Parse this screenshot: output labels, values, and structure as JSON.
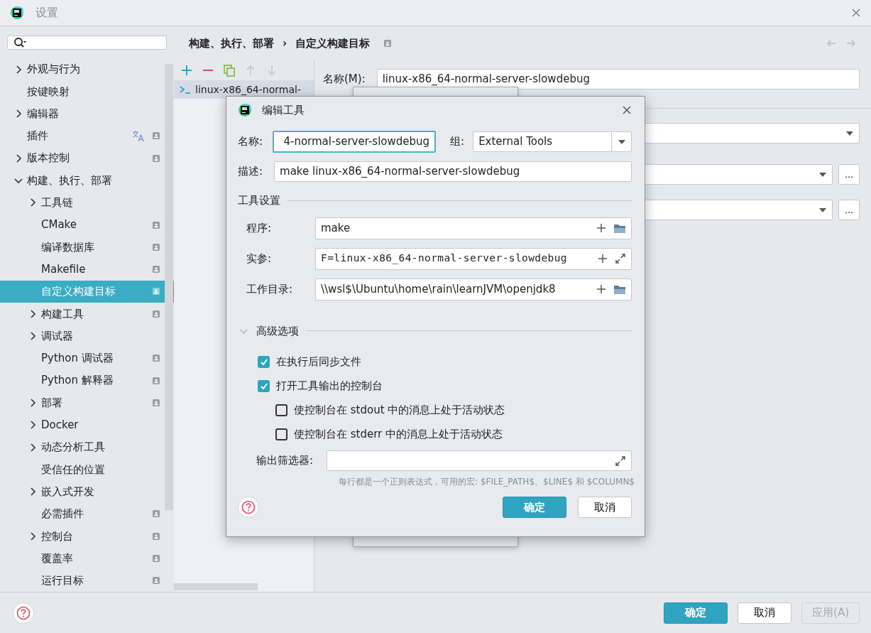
{
  "window": {
    "title": "设置"
  },
  "sidebar": {
    "items": [
      {
        "label": "外观与行为",
        "expanded": false,
        "badge": false,
        "selected": false
      },
      {
        "label": "按键映射",
        "badge": false,
        "selected": false
      },
      {
        "label": "编辑器",
        "expanded": false,
        "badge": false,
        "selected": false
      },
      {
        "label": "插件",
        "badge": true,
        "selected": false,
        "translate_icon": true
      },
      {
        "label": "版本控制",
        "expanded": false,
        "badge": true,
        "selected": false
      },
      {
        "label": "构建、执行、部署",
        "expanded": true,
        "badge": false,
        "selected": false,
        "children": [
          {
            "label": "工具链",
            "expanded": false,
            "badge": false,
            "selected": false
          },
          {
            "label": "CMake",
            "badge": true,
            "selected": false
          },
          {
            "label": "编译数据库",
            "badge": true,
            "selected": false
          },
          {
            "label": "Makefile",
            "badge": true,
            "selected": false
          },
          {
            "label": "自定义构建目标",
            "badge": true,
            "selected": true
          },
          {
            "label": "构建工具",
            "expanded": false,
            "badge": true,
            "selected": false
          },
          {
            "label": "调试器",
            "expanded": false,
            "badge": false,
            "selected": false
          },
          {
            "label": "Python 调试器",
            "badge": true,
            "selected": false
          },
          {
            "label": "Python 解释器",
            "badge": true,
            "selected": false
          },
          {
            "label": "部署",
            "expanded": false,
            "badge": true,
            "selected": false
          },
          {
            "label": "Docker",
            "expanded": false,
            "badge": false,
            "selected": false
          },
          {
            "label": "动态分析工具",
            "expanded": false,
            "badge": false,
            "selected": false
          },
          {
            "label": "受信任的位置",
            "badge": false,
            "selected": false
          },
          {
            "label": "嵌入式开发",
            "expanded": false,
            "badge": false,
            "selected": false
          },
          {
            "label": "必需插件",
            "badge": true,
            "selected": false
          },
          {
            "label": "控制台",
            "expanded": false,
            "badge": true,
            "selected": false
          },
          {
            "label": "覆盖率",
            "badge": true,
            "selected": false
          },
          {
            "label": "运行目标",
            "badge": true,
            "selected": false
          }
        ]
      }
    ]
  },
  "breadcrumb": {
    "items": [
      "构建、执行、部署",
      "自定义构建目标"
    ],
    "separator": "›",
    "badge": true
  },
  "toolbar": [
    {
      "kind": "add",
      "disabled": false
    },
    {
      "kind": "remove",
      "disabled": false
    },
    {
      "kind": "copy",
      "disabled": false
    },
    {
      "kind": "up",
      "disabled": true
    },
    {
      "kind": "down",
      "disabled": true
    }
  ],
  "targets": [
    {
      "label": "linux-x86_64-normal-",
      "selected": true
    }
  ],
  "form": {
    "name_label": "名称(M):",
    "name_value": "linux-x86_64-normal-server-slowdebug",
    "more_buttons": [
      "...",
      "..."
    ]
  },
  "edit_dialog": {
    "title": "编辑工具",
    "name": {
      "label": "名称:",
      "value": "4-normal-server-slowdebug",
      "focused": true
    },
    "group": {
      "label": "组:",
      "value": "External Tools"
    },
    "description": {
      "label": "描述:",
      "value": "make linux-x86_64-normal-server-slowdebug"
    },
    "section": "工具设置",
    "tool_fields": [
      {
        "label": "程序:",
        "value": "make",
        "kind": "browse",
        "monospace": false
      },
      {
        "label": "实参:",
        "value": "F=linux-x86_64-normal-server-slowdebug",
        "kind": "expand",
        "monospace": true
      },
      {
        "label": "工作目录:",
        "value": "\\\\wsl$\\Ubuntu\\home\\rain\\learnJVM\\openjdk8",
        "kind": "browse",
        "monospace": false
      }
    ],
    "advanced": {
      "label": "高级选项",
      "expanded": true,
      "options": [
        {
          "label": "在执行后同步文件",
          "checked": true
        },
        {
          "label": "打开工具输出的控制台",
          "checked": true,
          "children": [
            {
              "label": "使控制台在 stdout 中的消息上处于活动状态",
              "checked": false
            },
            {
              "label": "使控制台在 stderr 中的消息上处于活动状态",
              "checked": false
            }
          ]
        }
      ]
    },
    "filter": {
      "label": "输出筛选器:"
    },
    "hint": "每行都是一个正则表达式，可用的宏: $FILE_PATH$、$LINE$ 和 $COLUMN$",
    "buttons": [
      {
        "label": "确定",
        "kind": "primary"
      },
      {
        "label": "取消",
        "kind": "secondary"
      }
    ]
  },
  "footer": {
    "buttons": [
      {
        "label": "确定",
        "kind": "primary",
        "disabled": false
      },
      {
        "label": "取消",
        "kind": "secondary",
        "disabled": false
      },
      {
        "label": "应用(A)",
        "kind": "secondary",
        "disabled": true
      }
    ]
  }
}
